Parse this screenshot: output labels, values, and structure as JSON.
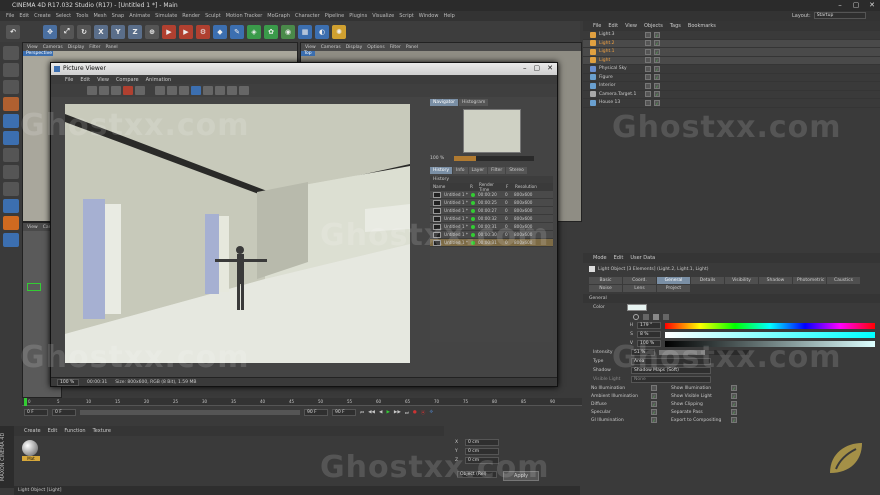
{
  "app": {
    "title": "CINEMA 4D R17.032 Studio (R17) - [Untitled 1 *] - Main",
    "layout_label": "Layout:",
    "layout_value": "Startup"
  },
  "menu": [
    "File",
    "Edit",
    "Create",
    "Select",
    "Tools",
    "Mesh",
    "Snap",
    "Animate",
    "Simulate",
    "Render",
    "Sculpt",
    "Motion Tracker",
    "MoGraph",
    "Character",
    "Pipeline",
    "Plugins",
    "Visualize",
    "Script",
    "Window",
    "Help"
  ],
  "toolbar": {
    "x": "X",
    "y": "Y",
    "z": "Z"
  },
  "viewport_left": {
    "menu": [
      "View",
      "Cameras",
      "Display",
      "Filter",
      "Panel"
    ],
    "label": "Perspective"
  },
  "viewport_right": {
    "menu": [
      "View",
      "Cameras",
      "Display",
      "Options",
      "Filter",
      "Panel"
    ],
    "label": "Top"
  },
  "viewport_small": {
    "menu": [
      "View",
      "Cam"
    ]
  },
  "picture_viewer": {
    "title": "Picture Viewer",
    "menu": [
      "File",
      "Edit",
      "View",
      "Compare",
      "Animation"
    ],
    "navigator_tabs": [
      "Navigator",
      "Histogram"
    ],
    "zoom": "100 %",
    "history_tabs": [
      "History",
      "Info",
      "Layer",
      "Filter",
      "Stereo"
    ],
    "history_label": "History",
    "history_columns": [
      "Name",
      "R",
      "Render Time",
      "F",
      "Resolution"
    ],
    "history_rows": [
      {
        "name": "Untitled 1 *",
        "time": "00:00:20",
        "f": "0",
        "res": "800x600"
      },
      {
        "name": "Untitled 1 *",
        "time": "00:00:25",
        "f": "0",
        "res": "800x600"
      },
      {
        "name": "Untitled 1 *",
        "time": "00:00:27",
        "f": "0",
        "res": "800x600"
      },
      {
        "name": "Untitled 1 *",
        "time": "00:00:32",
        "f": "0",
        "res": "800x600"
      },
      {
        "name": "Untitled 1 *",
        "time": "00:00:31",
        "f": "0",
        "res": "800x600"
      },
      {
        "name": "Untitled 1 *",
        "time": "00:00:30",
        "f": "0",
        "res": "800x600"
      },
      {
        "name": "Untitled 1 *",
        "time": "00:00:31",
        "f": "0",
        "res": "800x600"
      }
    ],
    "status": {
      "zoom": "100 %",
      "time": "00:00:31",
      "size": "Size: 800x600, RGB (8 Bit), 1.59 MB"
    }
  },
  "object_manager": {
    "menu": [
      "File",
      "Edit",
      "View",
      "Objects",
      "Tags",
      "Bookmarks"
    ],
    "objects": [
      {
        "name": "Light.3",
        "color": "#e0a040"
      },
      {
        "name": "Light.2",
        "color": "#e0a040"
      },
      {
        "name": "Light.1",
        "color": "#e0a040"
      },
      {
        "name": "Light",
        "color": "#e0a040"
      },
      {
        "name": "Physical Sky",
        "color": "#6a8fd0"
      },
      {
        "name": "Figure",
        "color": "#6aa0d0"
      },
      {
        "name": "Interior",
        "color": "#6aa0d0"
      },
      {
        "name": "Camera.Target.1",
        "color": "#aaaaaa"
      },
      {
        "name": "House 13",
        "color": "#6aa0d0"
      }
    ]
  },
  "attributes": {
    "menu": [
      "Mode",
      "Edit",
      "User Data"
    ],
    "header": "Light Object [3 Elements] (Light.2, Light.1, Light)",
    "tabs": [
      "Basic",
      "Coord.",
      "General",
      "Details",
      "Visibility",
      "Shadow",
      "Photometric",
      "Caustics",
      "Noise",
      "Lens",
      "Project"
    ],
    "active_tab": "General",
    "section": "General",
    "color_label": "Color",
    "h": {
      "label": "H",
      "value": "179 °"
    },
    "s": {
      "label": "S",
      "value": "8 %"
    },
    "v": {
      "label": "V",
      "value": "100 %"
    },
    "intensity": {
      "label": "Intensity",
      "value": "51 %"
    },
    "type": {
      "label": "Type",
      "value": "Area"
    },
    "shadow": {
      "label": "Shadow",
      "value": "Shadow Maps (Soft)"
    },
    "visible_light": {
      "label": "Visible Light",
      "value": "None"
    },
    "checks_left": [
      "No Illumination",
      "Ambient Illumination",
      "Diffuse",
      "Specular",
      "GI Illumination"
    ],
    "checks_right": [
      "Show Illumination",
      "Show Visible Light",
      "Show Clipping",
      "Separate Pass",
      "Export to Compositing"
    ]
  },
  "timeline": {
    "ticks": [
      "0",
      "5",
      "10",
      "15",
      "20",
      "25",
      "30",
      "35",
      "40",
      "45",
      "50",
      "55",
      "60",
      "65",
      "70",
      "75",
      "80",
      "85",
      "90"
    ],
    "frame": "0 F",
    "start": "0 F",
    "end": "90 F",
    "end2": "90 F",
    "current": "0 F"
  },
  "material_manager": {
    "menu": [
      "Create",
      "Edit",
      "Function",
      "Texture"
    ],
    "material_name": "Mat"
  },
  "coordinates": {
    "rows": [
      "X",
      "Y",
      "Z"
    ],
    "values": [
      "0 cm",
      "0 cm",
      "0 cm"
    ],
    "dropdown": "Object (Rel)",
    "apply": "Apply"
  },
  "status_bar": {
    "text": "Light Object [Light]"
  },
  "brand": {
    "side": "MAXON CINEMA 4D"
  },
  "watermark": "Ghostxx.com"
}
